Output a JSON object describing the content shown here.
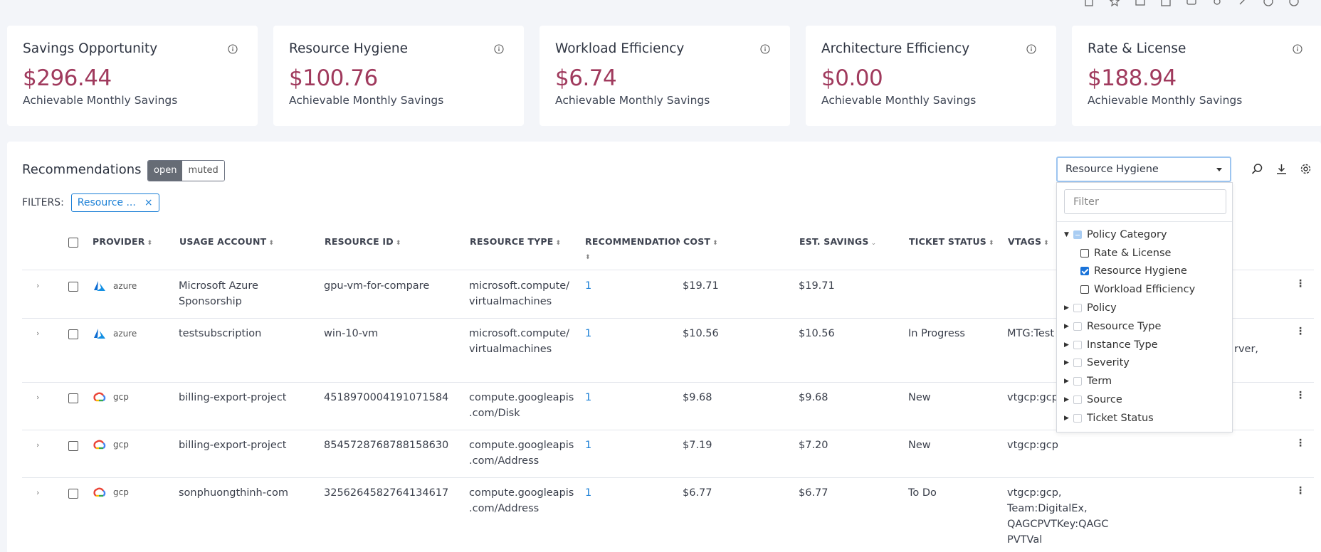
{
  "cards": [
    {
      "title": "Savings Opportunity",
      "value": "$296.44",
      "sub": "Achievable Monthly Savings"
    },
    {
      "title": "Resource Hygiene",
      "value": "$100.76",
      "sub": "Achievable Monthly Savings"
    },
    {
      "title": "Workload Efficiency",
      "value": "$6.74",
      "sub": "Achievable Monthly Savings"
    },
    {
      "title": "Architecture Efficiency",
      "value": "$0.00",
      "sub": "Achievable Monthly Savings"
    },
    {
      "title": "Rate & License",
      "value": "$188.94",
      "sub": "Achievable Monthly Savings"
    }
  ],
  "recommendations": {
    "title": "Recommendations",
    "toggle_open": "open",
    "toggle_muted": "muted",
    "filters_label": "FILTERS:",
    "filter_chip": "Resource ...",
    "chip_close": "×",
    "dropdown_value": "Resource Hygiene"
  },
  "columns": {
    "provider": "PROVIDER",
    "usage_account": "USAGE ACCOUNT",
    "resource_id": "RESOURCE ID",
    "resource_type": "RESOURCE TYPE",
    "recommendation": "RECOMMENDATION",
    "cost": "COST",
    "est_savings": "EST. SAVINGS",
    "ticket_status": "TICKET STATUS",
    "vtags": "VTAGS"
  },
  "rows": [
    {
      "provider": "azure",
      "account1": "Microsoft Azure",
      "account2": "Sponsorship",
      "rid": "gpu-vm-for-compare",
      "type1": "microsoft.compute/",
      "type2": "virtualmachines",
      "rec": "1",
      "cost": "$19.71",
      "save": "$19.71",
      "status": "",
      "tag1": "",
      "tag2": "",
      "tag3": "",
      "tag4": ""
    },
    {
      "provider": "azure",
      "account1": "testsubscription",
      "account2": "",
      "rid": "win-10-vm",
      "type1": "microsoft.compute/",
      "type2": "virtualmachines",
      "rec": "1",
      "cost": "$10.56",
      "save": "$10.56",
      "status": "In Progress",
      "tag1": "MTG:Test",
      "tag2": "",
      "tag3": "",
      "tag4": "",
      "overflow": "rver,"
    },
    {
      "provider": "gcp",
      "account1": "billing-export-project",
      "account2": "",
      "rid": "4518970004191071584",
      "type1": "compute.googleapis",
      "type2": ".com/Disk",
      "rec": "1",
      "cost": "$9.68",
      "save": "$9.68",
      "status": "New",
      "tag1": "vtgcp:gcp",
      "tag2": "",
      "tag3": "",
      "tag4": ""
    },
    {
      "provider": "gcp",
      "account1": "billing-export-project",
      "account2": "",
      "rid": "8545728768788158630",
      "type1": "compute.googleapis",
      "type2": ".com/Address",
      "rec": "1",
      "cost": "$7.19",
      "save": "$7.20",
      "status": "New",
      "tag1": "vtgcp:gcp",
      "tag2": "",
      "tag3": "",
      "tag4": ""
    },
    {
      "provider": "gcp",
      "account1": "sonphuongthinh-com",
      "account2": "",
      "rid": "3256264582764134617",
      "type1": "compute.googleapis",
      "type2": ".com/Address",
      "rec": "1",
      "cost": "$6.77",
      "save": "$6.77",
      "status": "To Do",
      "tag1": "vtgcp:gcp,",
      "tag2": "Team:DigitalEx,",
      "tag3": "QAGCPVTKey:QAGC",
      "tag4": "PVTVal"
    }
  ],
  "popup": {
    "filter_placeholder": "Filter",
    "root": "Policy Category",
    "children": [
      "Rate & License",
      "Resource Hygiene",
      "Workload Efficiency"
    ],
    "groups": [
      "Policy",
      "Resource Type",
      "Instance Type",
      "Severity",
      "Term",
      "Source",
      "Ticket Status"
    ]
  }
}
